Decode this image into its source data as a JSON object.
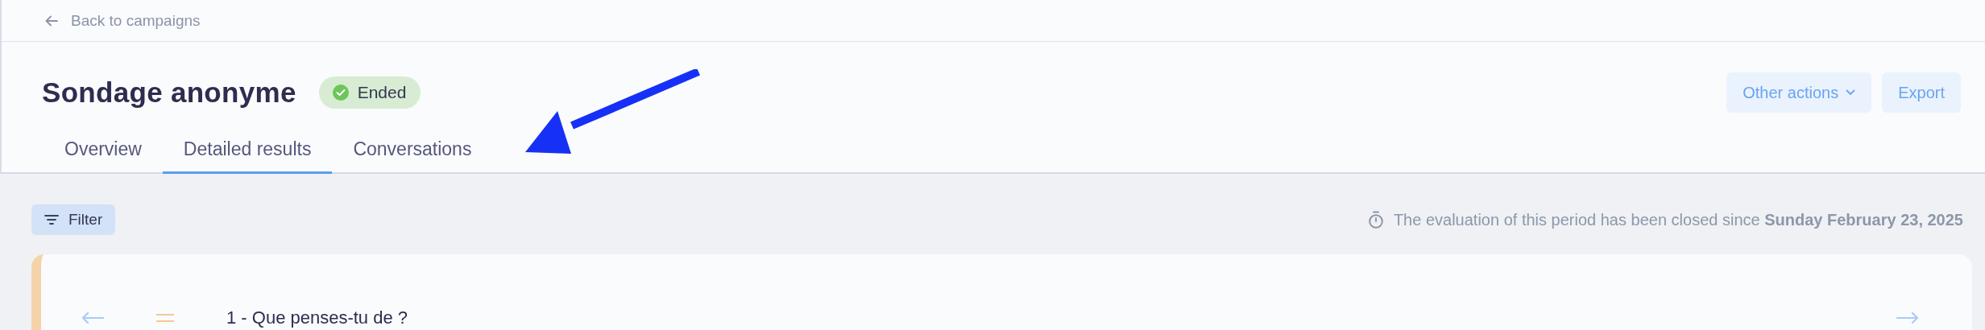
{
  "back_link": {
    "label": "Back to campaigns"
  },
  "header": {
    "title": "Sondage anonyme",
    "status": {
      "label": "Ended",
      "kind": "success"
    }
  },
  "actions": [
    {
      "label": "Other actions",
      "dropdown": true
    },
    {
      "label": "Export",
      "dropdown": false
    }
  ],
  "tabs": [
    {
      "label": "Overview",
      "selected": false
    },
    {
      "label": "Detailed results",
      "selected": true
    },
    {
      "label": "Conversations",
      "selected": false
    }
  ],
  "filter_button": {
    "label": "Filter"
  },
  "closed_notice": "The evaluation of this period has been closed since **Sunday February 23, 2025**",
  "question_card": {
    "title": "1 - Que penses-tu de ?",
    "color": "#f5d3a8"
  }
}
